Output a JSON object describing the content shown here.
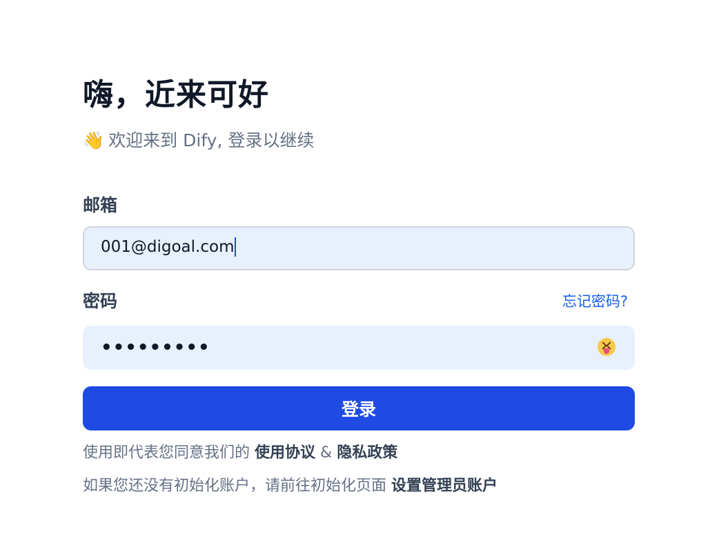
{
  "header": {
    "title": "嗨，近来可好",
    "subtitle": "欢迎来到 Dify, 登录以继续",
    "subtitle_emoji": "👋"
  },
  "form": {
    "email_label": "邮箱",
    "email_value": "001@digoal.com",
    "password_label": "密码",
    "forgot_link": "忘记密码?",
    "password_mask": "•••••••••",
    "toggle_icon": "squinting-face-with-tongue-icon",
    "submit_label": "登录"
  },
  "footer": {
    "terms_prefix": "使用即代表您同意我们的",
    "terms_link": "使用协议",
    "terms_and": "&",
    "privacy_link": "隐私政策",
    "init_text": "如果您还没有初始化账户，请前往初始化页面",
    "init_link": "设置管理员账户"
  },
  "colors": {
    "primary": "#1f4ae3",
    "link": "#155eef",
    "input_bg": "#e8effd"
  }
}
